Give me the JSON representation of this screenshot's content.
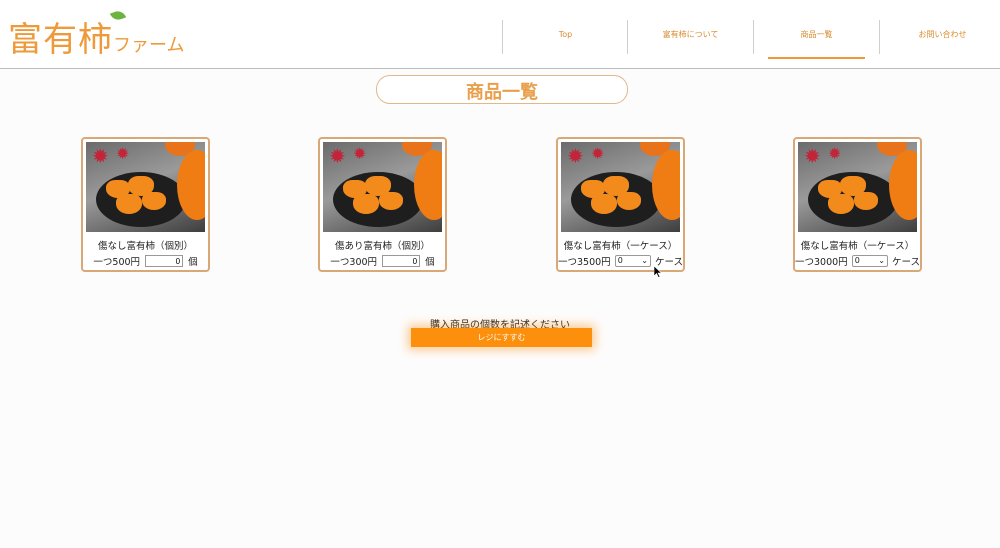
{
  "header": {
    "logo_main": "富有柿",
    "logo_sub": "ファーム",
    "nav": [
      {
        "label": "Top",
        "active": false
      },
      {
        "label": "富有柿について",
        "active": false
      },
      {
        "label": "商品一覧",
        "active": true
      },
      {
        "label": "お問い合わせ",
        "active": false
      }
    ]
  },
  "main": {
    "title": "商品一覧",
    "products": [
      {
        "name": "傷なし富有柿（個別）",
        "price": "一つ500円",
        "value": "0",
        "unit": "個",
        "control": "input"
      },
      {
        "name": "傷あり富有柿（個別）",
        "price": "一つ300円",
        "value": "0",
        "unit": "個",
        "control": "input"
      },
      {
        "name": "傷なし富有柿（一ケース）",
        "price": "一つ3500円",
        "value": "0",
        "unit": "ケース",
        "control": "select"
      },
      {
        "name": "傷なし富有柿（一ケース）",
        "price": "一つ3000円",
        "value": "0",
        "unit": "ケース",
        "control": "select"
      }
    ],
    "instruction": "購入商品の個数を記述ください",
    "checkout_label": "レジにすすむ"
  },
  "colors": {
    "accent": "#ef9a3a",
    "button": "#fc8f0c"
  }
}
